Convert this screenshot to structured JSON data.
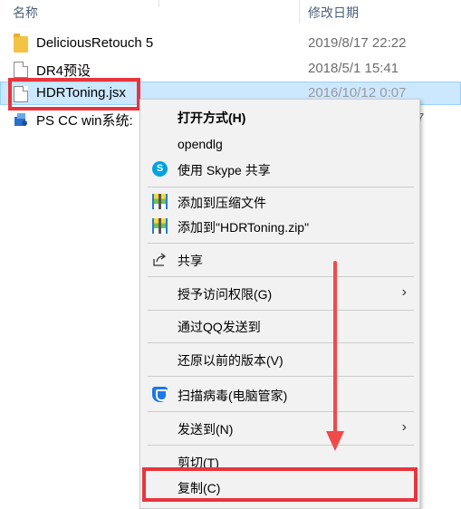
{
  "columns": {
    "name": "名称",
    "date": "修改日期"
  },
  "files": [
    {
      "name": "DeliciousRetouch 5",
      "date": "2019/8/17 22:22",
      "icon": "folder-icon"
    },
    {
      "name": "DR4预设",
      "date": "2018/5/1 15:41",
      "icon": "file-icon"
    },
    {
      "name": "HDRToning.jsx",
      "date": "2016/10/12 0:07",
      "icon": "file-icon"
    },
    {
      "name": "PS CC  win系统:",
      "date": "7",
      "icon": "installer-icon"
    }
  ],
  "menu": {
    "items": [
      {
        "label": "打开方式(H)",
        "bold": true
      },
      {
        "label": "opendlg"
      },
      {
        "label": "使用 Skype 共享",
        "icon": "skype-icon"
      },
      {
        "label": "添加到压缩文件",
        "icon": "zip-icon"
      },
      {
        "label": "添加到\"HDRToning.zip\"",
        "icon": "zip-icon"
      },
      {
        "label": "共享",
        "icon": "share-icon"
      },
      {
        "label": "授予访问权限(G)",
        "submenu": true
      },
      {
        "label": "通过QQ发送到"
      },
      {
        "label": "还原以前的版本(V)"
      },
      {
        "label": "扫描病毒(电脑管家)",
        "icon": "shield-icon"
      },
      {
        "label": "发送到(N)",
        "submenu": true
      },
      {
        "label": "剪切(T)"
      },
      {
        "label": "复制(C)"
      }
    ],
    "submenu_arrow": "›"
  },
  "colors": {
    "highlight": "#e8353d",
    "selection": "#cce8ff",
    "arrow": "#f04a4a"
  }
}
